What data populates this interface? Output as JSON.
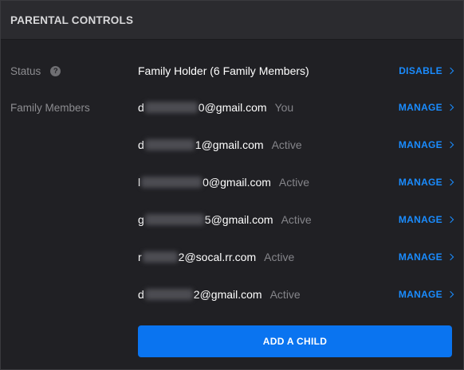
{
  "header": {
    "title": "PARENTAL CONTROLS"
  },
  "status_row": {
    "label": "Status",
    "help_icon": "?",
    "value": "Family Holder (6 Family Members)",
    "action": "DISABLE"
  },
  "members_label": "Family Members",
  "members": [
    {
      "prefix": "d",
      "suffix": "0@gmail.com",
      "status": "You",
      "action": "MANAGE"
    },
    {
      "prefix": "d",
      "suffix": "1@gmail.com",
      "status": "Active",
      "action": "MANAGE"
    },
    {
      "prefix": "l",
      "suffix": "0@gmail.com",
      "status": "Active",
      "action": "MANAGE"
    },
    {
      "prefix": "g",
      "suffix": "5@gmail.com",
      "status": "Active",
      "action": "MANAGE"
    },
    {
      "prefix": "r",
      "suffix": "2@socal.rr.com",
      "status": "Active",
      "action": "MANAGE"
    },
    {
      "prefix": "d",
      "suffix": "2@gmail.com",
      "status": "Active",
      "action": "MANAGE"
    }
  ],
  "add_child_label": "ADD A CHILD",
  "colors": {
    "background": "#202024",
    "header_bg": "#2b2b2f",
    "accent": "#1a8cff",
    "button": "#0a74f0",
    "muted_text": "#8c8c90"
  }
}
